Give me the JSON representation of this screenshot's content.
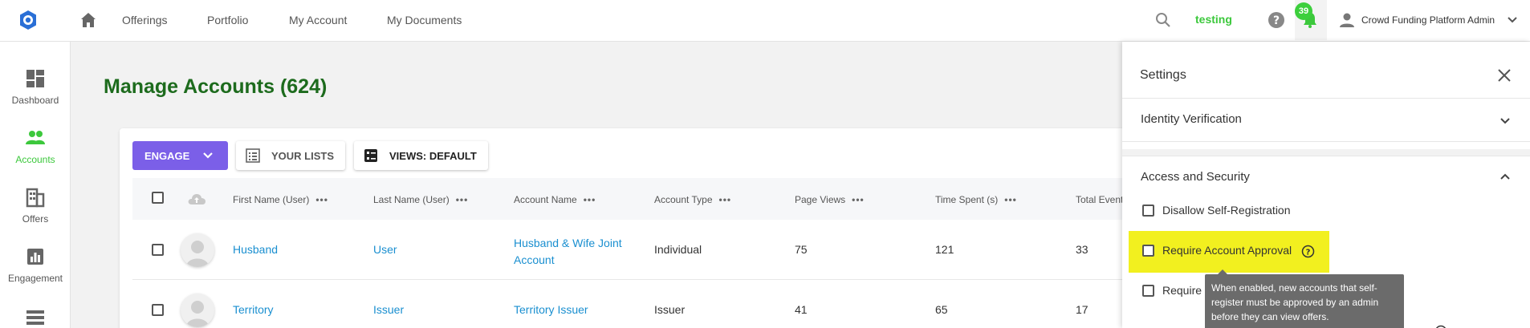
{
  "topbar": {
    "logo_icon": "app-logo-icon",
    "nav": [
      "Offerings",
      "Portfolio",
      "My Account",
      "My Documents"
    ],
    "env_label": "testing",
    "notification_count": "39",
    "account_name": "Crowd Funding Platform Admin"
  },
  "sidebar": {
    "items": [
      {
        "label": "Dashboard",
        "icon": "dashboard-icon"
      },
      {
        "label": "Accounts",
        "icon": "people-icon",
        "active": true
      },
      {
        "label": "Offers",
        "icon": "building-icon"
      },
      {
        "label": "Engagement",
        "icon": "chart-icon"
      }
    ]
  },
  "main": {
    "title": "Manage Accounts (624)",
    "toolbar": {
      "engage": "ENGAGE",
      "lists": "YOUR LISTS",
      "views": "VIEWS: DEFAULT"
    },
    "columns": [
      "First Name (User)",
      "Last Name (User)",
      "Account Name",
      "Account Type",
      "Page Views",
      "Time Spent (s)",
      "Total Events"
    ],
    "column_menu": "•••",
    "rows": [
      {
        "first": "Husband",
        "last": "User",
        "account_line1": "Husband & Wife Joint",
        "account_line2": "Account",
        "type": "Individual",
        "views": "75",
        "time": "121",
        "events": "33"
      },
      {
        "first": "Territory",
        "last": "Issuer",
        "account_line1": "Territory Issuer",
        "account_line2": "",
        "type": "Issuer",
        "views": "41",
        "time": "65",
        "events": "17"
      }
    ]
  },
  "settings": {
    "title": "Settings",
    "sections": [
      "Identity Verification",
      "Access and Security"
    ],
    "options": [
      "Disallow Self-Registration",
      "Require Account Approval",
      "Require M"
    ],
    "tooltip": "When enabled, new accounts that self-register must be approved by an admin before they can view offers."
  },
  "colors": {
    "accent_green": "#3cc83c",
    "title_green": "#1d6b1d",
    "engage_purple": "#7b5fe8",
    "link_blue": "#1a8fd0",
    "highlight_yellow": "#f2f01f"
  }
}
